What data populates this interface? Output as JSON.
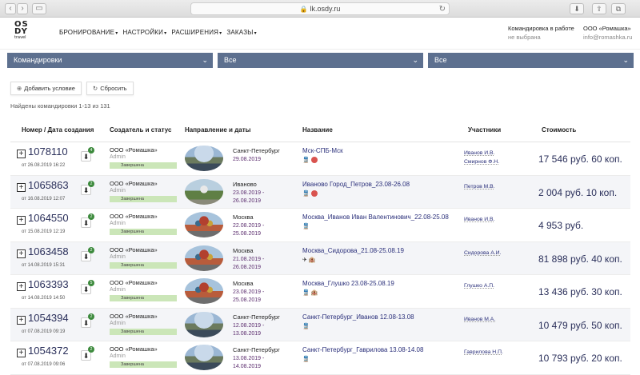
{
  "browser": {
    "url": "lk.osdy.ru"
  },
  "logo": {
    "line1": "OS",
    "line2": "DY",
    "sub": "travel"
  },
  "nav": [
    {
      "label": "БРОНИРОВАНИЕ"
    },
    {
      "label": "НАСТРОЙКИ"
    },
    {
      "label": "РАСШИРЕНИЯ"
    },
    {
      "label": "ЗАКАЗЫ"
    }
  ],
  "trip": {
    "title": "Командировка в работе",
    "value": "не выбрана"
  },
  "company": {
    "name": "ООО «Ромашка»",
    "email": "info@romashka.ru"
  },
  "filters": [
    {
      "label": "Командировки"
    },
    {
      "label": "Все"
    },
    {
      "label": "Все"
    }
  ],
  "actions": {
    "add": "Добавить условие",
    "reset": "Сбросить"
  },
  "found_text": "Найдены командировки 1-13 из 131",
  "columns": {
    "number": "Номер / Дата создания",
    "creator": "Создатель и статус",
    "route": "Направление и даты",
    "name": "Название",
    "people": "Участники",
    "cost": "Стоимость"
  },
  "rows": [
    {
      "number": "1078110",
      "created": "от 26.08.2019 16:22",
      "count": "4",
      "org": "ООО «Ромашка»",
      "role": "Admin",
      "status": "Завершена",
      "city": "Санкт-Петербург",
      "d1": "29.08.2019",
      "d2": "",
      "thumb": "spb",
      "name": "Мск-СПБ-Мск",
      "icons": "🚆",
      "red": true,
      "people": [
        "Иванов И.В.",
        "Смирнов Ф.Н."
      ],
      "cost": "17 546 руб. 60 коп."
    },
    {
      "number": "1065863",
      "created": "от 16.08.2019 12:07",
      "count": "2",
      "org": "ООО «Ромашка»",
      "role": "Admin",
      "status": "Завершена",
      "city": "Иваново",
      "d1": "23.08.2019 -",
      "d2": "26.08.2019",
      "thumb": "ivn",
      "name": "Иваново Город_Петров_23.08-26.08",
      "icons": "🚆",
      "red": true,
      "people": [
        "Петров М.В."
      ],
      "cost": "2 004 руб. 10 коп."
    },
    {
      "number": "1064550",
      "created": "от 15.08.2019 12:19",
      "count": "2",
      "org": "ООО «Ромашка»",
      "role": "Admin",
      "status": "Завершена",
      "city": "Москва",
      "d1": "22.08.2019 -",
      "d2": "25.08.2019",
      "thumb": "msk",
      "name": "Москва_Иванов Иван Валентинович_22.08-25.08",
      "icons": "🚆",
      "red": false,
      "people": [
        "Иванов И.В."
      ],
      "cost": "4 953 руб."
    },
    {
      "number": "1063458",
      "created": "от 14.08.2019 15:31",
      "count": "2",
      "org": "ООО «Ромашка»",
      "role": "Admin",
      "status": "Завершена",
      "city": "Москва",
      "d1": "21.08.2019 -",
      "d2": "26.08.2019",
      "thumb": "msk",
      "name": "Москва_Сидорова_21.08-25.08.19",
      "icons": "✈ 🏨",
      "red": false,
      "people": [
        "Сидорова А.И."
      ],
      "cost": "81 898 руб. 40 коп."
    },
    {
      "number": "1063393",
      "created": "от 14.08.2019 14:50",
      "count": "5",
      "org": "ООО «Ромашка»",
      "role": "Admin",
      "status": "Завершена",
      "city": "Москва",
      "d1": "23.08.2019 -",
      "d2": "25.08.2019",
      "thumb": "msk",
      "name": "Москва_Глушко 23.08-25.08.19",
      "icons": "🚆 🏨",
      "red": false,
      "people": [
        "Глушко А.П."
      ],
      "cost": "13 436 руб. 30 коп."
    },
    {
      "number": "1054394",
      "created": "от 07.08.2019 09:19",
      "count": "2",
      "org": "ООО «Ромашка»",
      "role": "Admin",
      "status": "Завершена",
      "city": "Санкт-Петербург",
      "d1": "12.08.2019 -",
      "d2": "13.08.2019",
      "thumb": "spb",
      "name": "Санкт-Петербург_Иванов 12.08-13.08",
      "icons": "🚆",
      "red": false,
      "people": [
        "Иванов М.А."
      ],
      "cost": "10 479 руб. 50 коп."
    },
    {
      "number": "1054372",
      "created": "от 07.08.2019 09:06",
      "count": "2",
      "org": "ООО «Ромашка»",
      "role": "Admin",
      "status": "Завершена",
      "city": "Санкт-Петербург",
      "d1": "13.08.2019 -",
      "d2": "14.08.2019",
      "thumb": "spb",
      "name": "Санкт-Петербург_Гаврилова 13.08-14.08",
      "icons": "🚆",
      "red": false,
      "people": [
        "Гаврилова Н.П."
      ],
      "cost": "10 793 руб. 20 коп."
    }
  ]
}
